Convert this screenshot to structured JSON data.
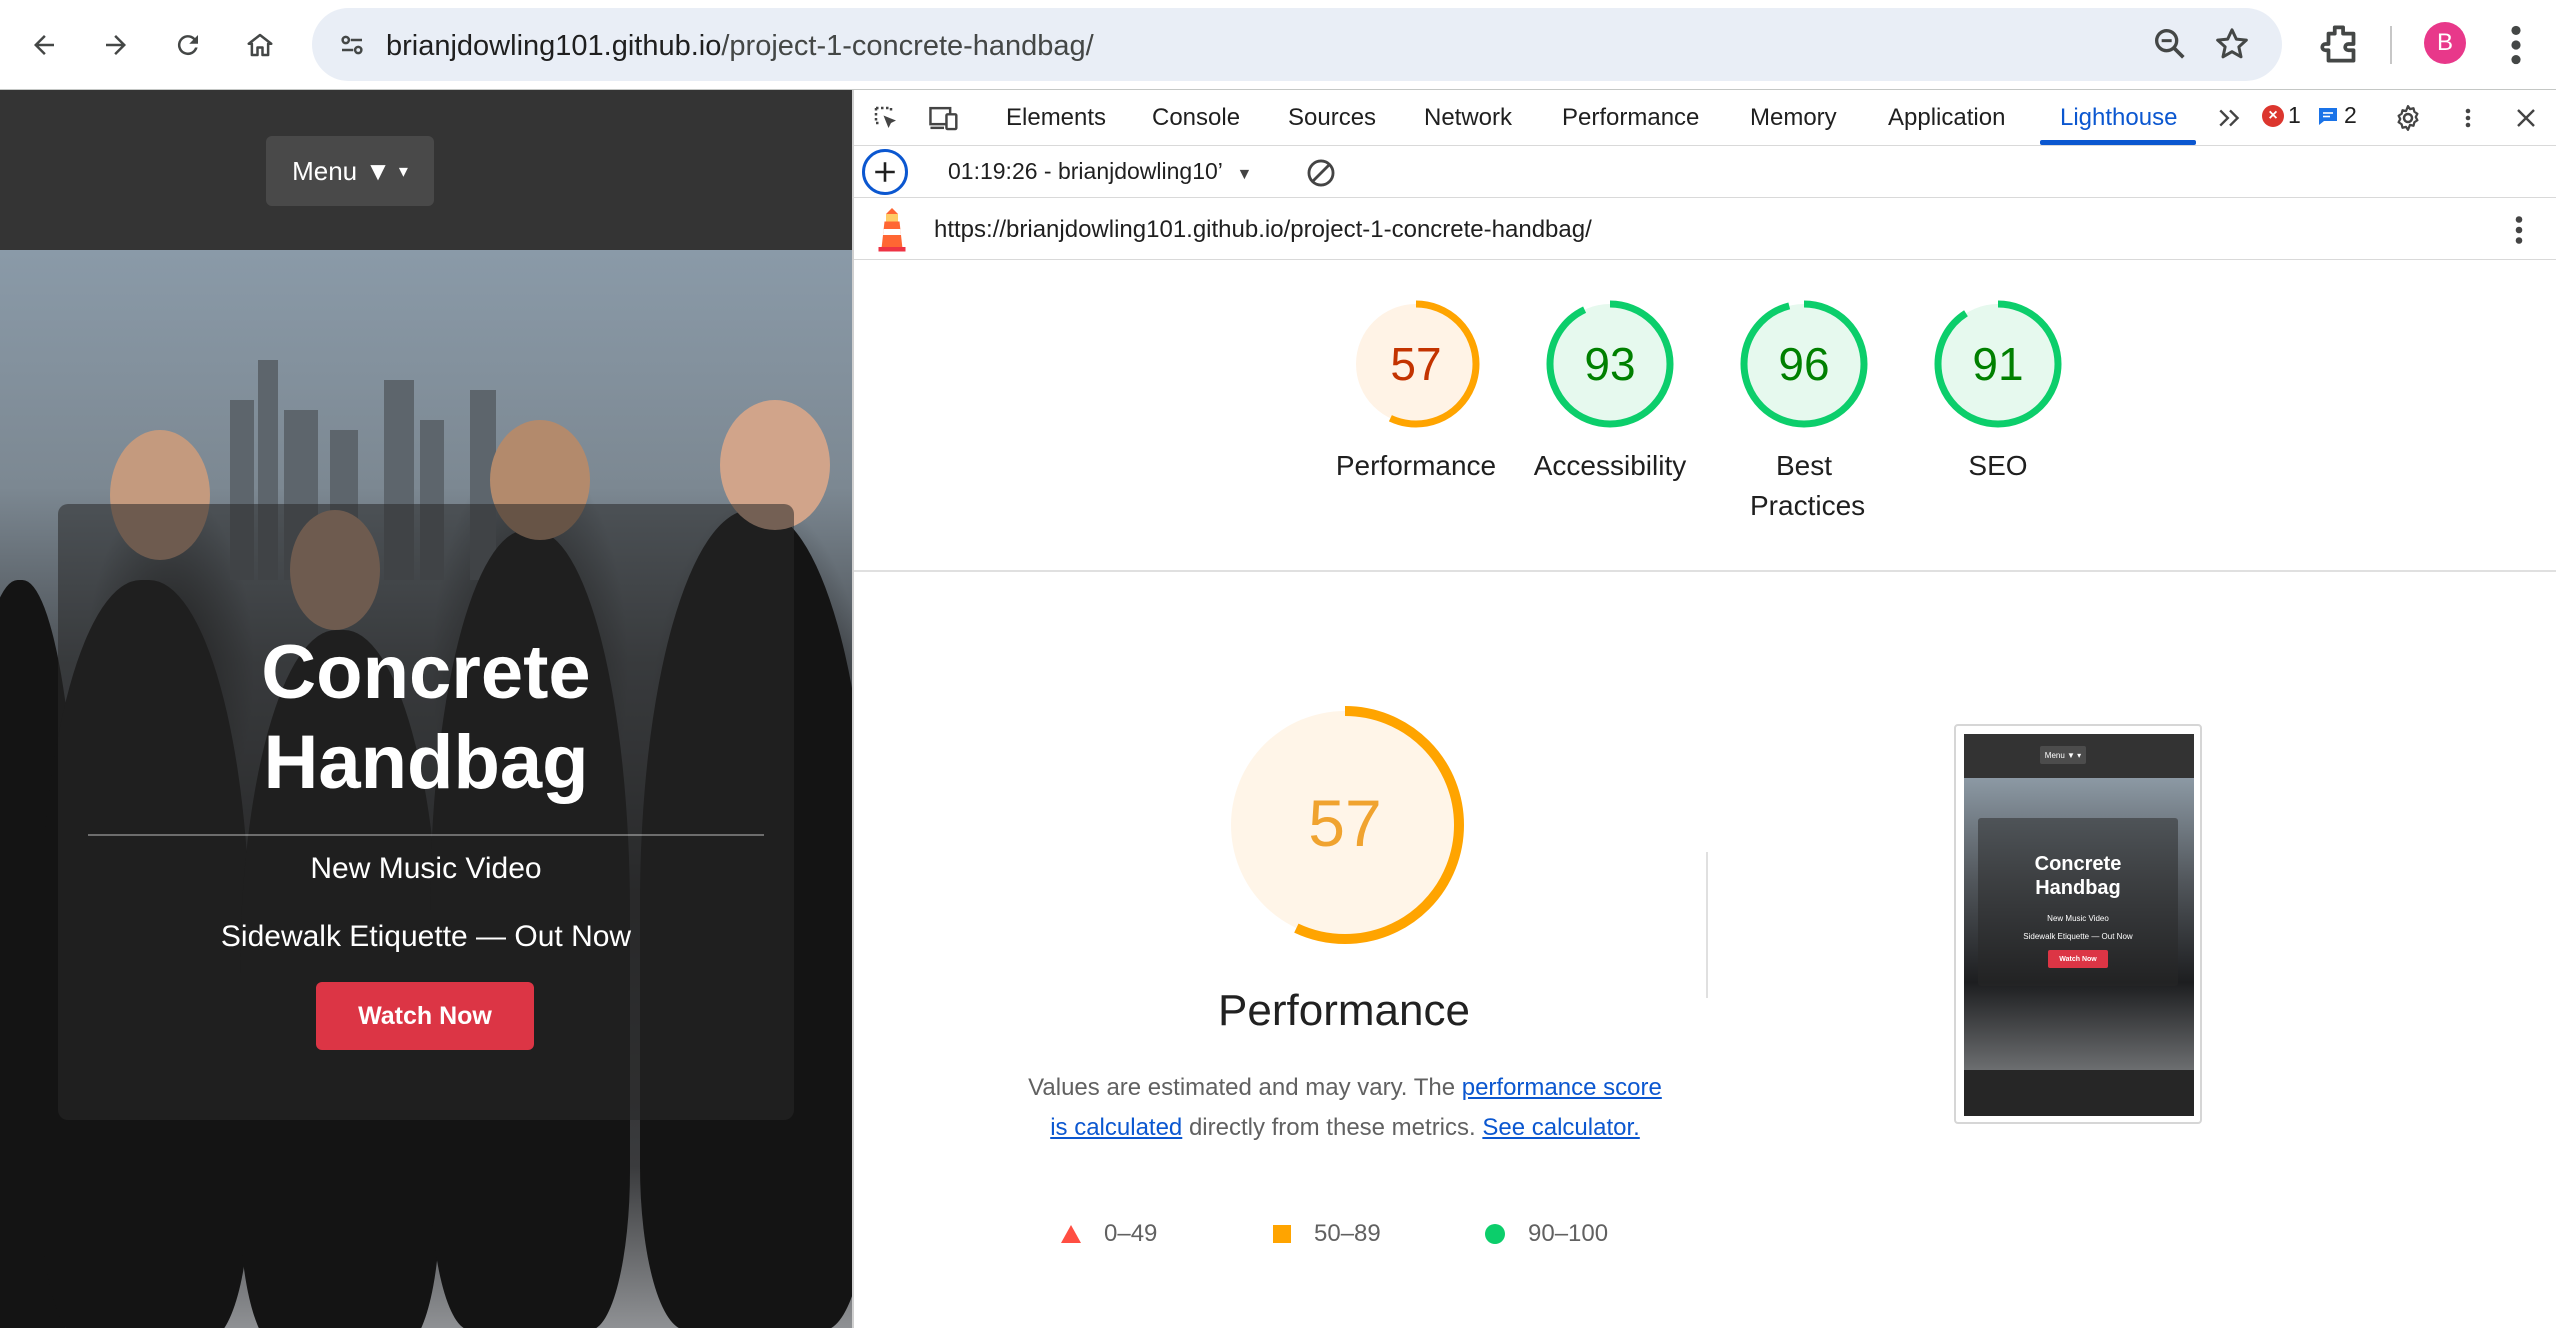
{
  "browser": {
    "url_host": "brianjdowling101.github.io",
    "url_path": "/project-1-concrete-handbag/",
    "profile_initial": "B"
  },
  "webpage": {
    "menu_label": "Menu",
    "menu_arrow": "▼",
    "hero_title": "Concrete Handbag",
    "hero_subtitle": "New Music Video",
    "hero_tagline": "Sidewalk Etiquette — Out Now",
    "cta_label": "Watch Now"
  },
  "devtools": {
    "tabs": [
      "Elements",
      "Console",
      "Sources",
      "Network",
      "Performance",
      "Memory",
      "Application",
      "Lighthouse"
    ],
    "active_tab": "Lighthouse",
    "error_count": "1",
    "message_count": "2",
    "report_select": "01:19:26 - brianjdowling10’",
    "report_url": "https://brianjdowling101.github.io/project-1-concrete-handbag/"
  },
  "lighthouse": {
    "scores": [
      {
        "label": "Performance",
        "score": 57,
        "color": "#e8710a",
        "stroke": "#ffa400",
        "bg": "#fff3e6"
      },
      {
        "label": "Accessibility",
        "score": 93,
        "color": "#0b8043",
        "stroke": "#0cce6b",
        "bg": "#e6f9ee"
      },
      {
        "label": "Best Practices",
        "score": 96,
        "color": "#0b8043",
        "stroke": "#0cce6b",
        "bg": "#e6f9ee"
      },
      {
        "label": "SEO",
        "score": 91,
        "color": "#0b8043",
        "stroke": "#0cce6b",
        "bg": "#e6f9ee"
      }
    ],
    "score_text_colors": {
      "Performance": "#c33300",
      "default": "#008000"
    },
    "main": {
      "score": 57,
      "score_color": "#f0a32f",
      "title": "Performance",
      "desc_prefix": "Values are estimated and may vary. The ",
      "desc_link1": "performance score is calculated",
      "desc_middle": " directly from these metrics. ",
      "desc_link2": "See calculator."
    },
    "legend": [
      {
        "shape": "triangle",
        "range": "0–49",
        "color": "#ff4e42"
      },
      {
        "shape": "square",
        "range": "50–89",
        "color": "#ffa400"
      },
      {
        "shape": "circle",
        "range": "90–100",
        "color": "#0cce6b"
      }
    ]
  },
  "thumbnail": {
    "menu_label": "Menu ▼ ▾",
    "title": "Concrete Handbag",
    "subtitle": "New Music Video",
    "tagline": "Sidewalk Etiquette — Out Now",
    "cta_label": "Watch Now"
  }
}
